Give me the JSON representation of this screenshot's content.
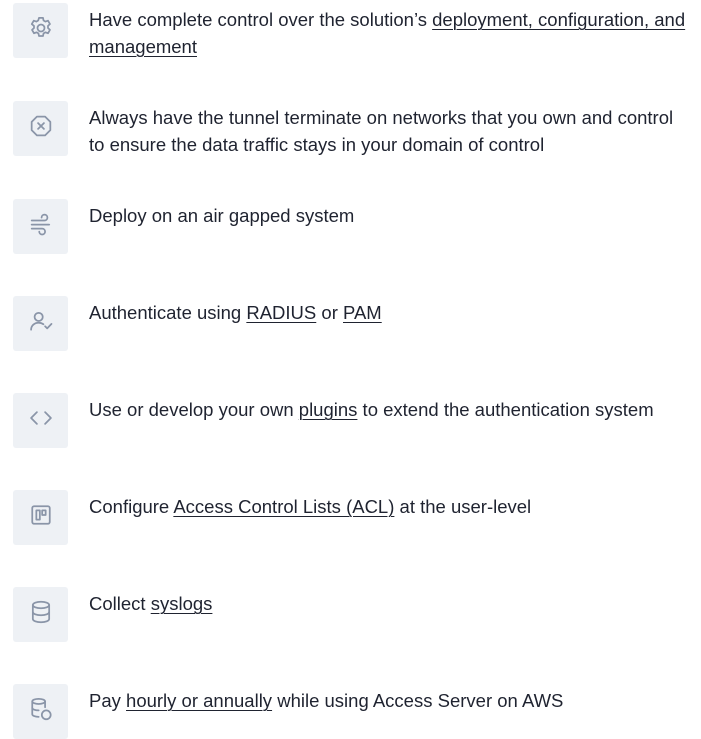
{
  "features": [
    {
      "icon": "gear-icon",
      "parts": [
        "Have complete control over the solution’s ",
        "deployment, configuration, and management",
        ""
      ]
    },
    {
      "icon": "close-circle-icon",
      "parts": [
        "Always have the tunnel terminate on networks that you own and control to ensure the data traffic stays in your domain of control"
      ]
    },
    {
      "icon": "wind-icon",
      "parts": [
        "Deploy on an air gapped system"
      ]
    },
    {
      "icon": "user-check-icon",
      "parts": [
        "Authenticate using ",
        "RADIUS",
        " or ",
        "PAM",
        ""
      ]
    },
    {
      "icon": "code-icon",
      "parts": [
        "Use or develop your own ",
        "plugins",
        " to extend the authentication system"
      ]
    },
    {
      "icon": "kanban-board-icon",
      "parts": [
        "Configure ",
        "Access Control Lists (ACL)",
        " at the user-level"
      ]
    },
    {
      "icon": "database-icon",
      "parts": [
        "Collect ",
        "syslogs",
        ""
      ]
    },
    {
      "icon": "database-coins-icon",
      "parts": [
        "Pay ",
        "hourly or annually",
        " while using Access Server on AWS"
      ]
    }
  ]
}
